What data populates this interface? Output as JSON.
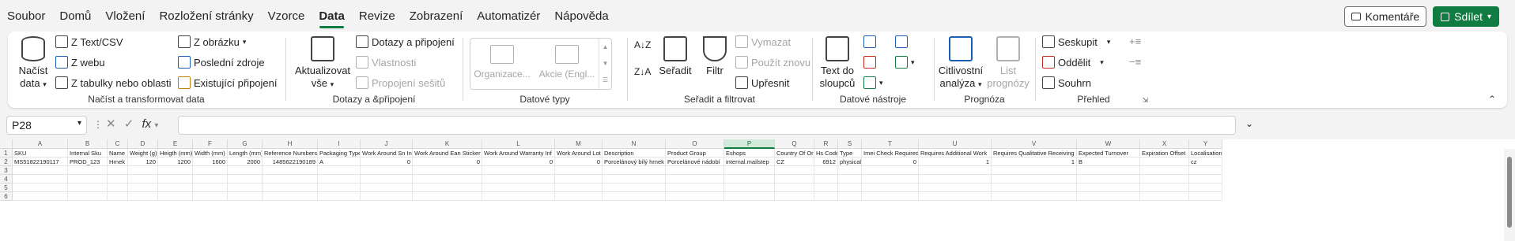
{
  "menu": {
    "tabs": [
      "Soubor",
      "Domů",
      "Vložení",
      "Rozložení stránky",
      "Vzorce",
      "Data",
      "Revize",
      "Zobrazení",
      "Automatizér",
      "Nápověda"
    ],
    "active": "Data",
    "komentare": "Komentáře",
    "sdilet": "Sdílet"
  },
  "ribbon": {
    "g1": {
      "nacist": "Načíst",
      "data": "data",
      "z_text": "Z Text/CSV",
      "z_webu": "Z webu",
      "z_tabulky": "Z tabulky nebo oblasti",
      "z_obrazku": "Z obrázku",
      "posledni": "Poslední zdroje",
      "existujici": "Existující připojení",
      "label": "Načíst a transformovat data"
    },
    "g2": {
      "aktualizovat": "Aktualizovat",
      "vse": "vše",
      "dotazy": "Dotazy a připojení",
      "vlastnosti": "Vlastnosti",
      "propojeni": "Propojení sešitů",
      "label": "Dotazy a &připojení"
    },
    "g3": {
      "organizace": "Organizace...",
      "akcie": "Akcie (Engl...",
      "label": "Datové typy"
    },
    "g4": {
      "seradit": "Seřadit",
      "filtr": "Filtr",
      "vymazat": "Vymazat",
      "pouzit": "Použít znovu",
      "upresnit": "Upřesnit",
      "label": "Seřadit a filtrovat"
    },
    "g5": {
      "text_do": "Text do",
      "sloupcu": "sloupců",
      "label": "Datové nástroje"
    },
    "g6": {
      "citlivostni": "Citlivostní",
      "analyza": "analýza",
      "list": "List",
      "prognozy": "prognózy",
      "label": "Prognóza"
    },
    "g7": {
      "seskupit": "Seskupit",
      "oddelit": "Oddělit",
      "souhrn": "Souhrn",
      "label": "Přehled"
    }
  },
  "formula": {
    "namebox": "P28",
    "fx": "fx",
    "value": ""
  },
  "sheet": {
    "columns": [
      "A",
      "B",
      "C",
      "D",
      "E",
      "F",
      "G",
      "H",
      "I",
      "J",
      "K",
      "L",
      "M",
      "N",
      "O",
      "P",
      "Q",
      "R",
      "S",
      "T",
      "U",
      "V",
      "W",
      "X",
      "Y"
    ],
    "selected_column": "P",
    "rows": [
      "1",
      "2",
      "3",
      "4",
      "5",
      "6"
    ],
    "header": [
      "SKU",
      "Internal Sku",
      "Name",
      "Weight (g)",
      "Heigth (mm)",
      "Width (mm)",
      "Length (mm)",
      "Reference Numbers",
      "Packaging Type",
      "Work Around Sn In",
      "Work Around Ean Sticker",
      "Work Around Warranty Inf",
      "Work Around Lot",
      "Description",
      "Product Group",
      "Eshops",
      "Country Of Origin",
      "Hs Code",
      "Type",
      "Imei Check Required",
      "Requires Additional Work",
      "Requires Qualitative Receiving",
      "Expected Turnover",
      "Expiration Offset",
      "Localisation"
    ],
    "row2": [
      "MS51822190117",
      "PROD_123",
      "Hrnek",
      "120",
      "1200",
      "1600",
      "2000",
      "1485622190189",
      "A",
      "0",
      "0",
      "0",
      "0",
      "Porcelánový bílý hrnek",
      "Porcelánové nádobí",
      "internal.mailstep",
      "CZ",
      "6912",
      "physical",
      "0",
      "1",
      "1",
      "B",
      "",
      "cz"
    ]
  }
}
